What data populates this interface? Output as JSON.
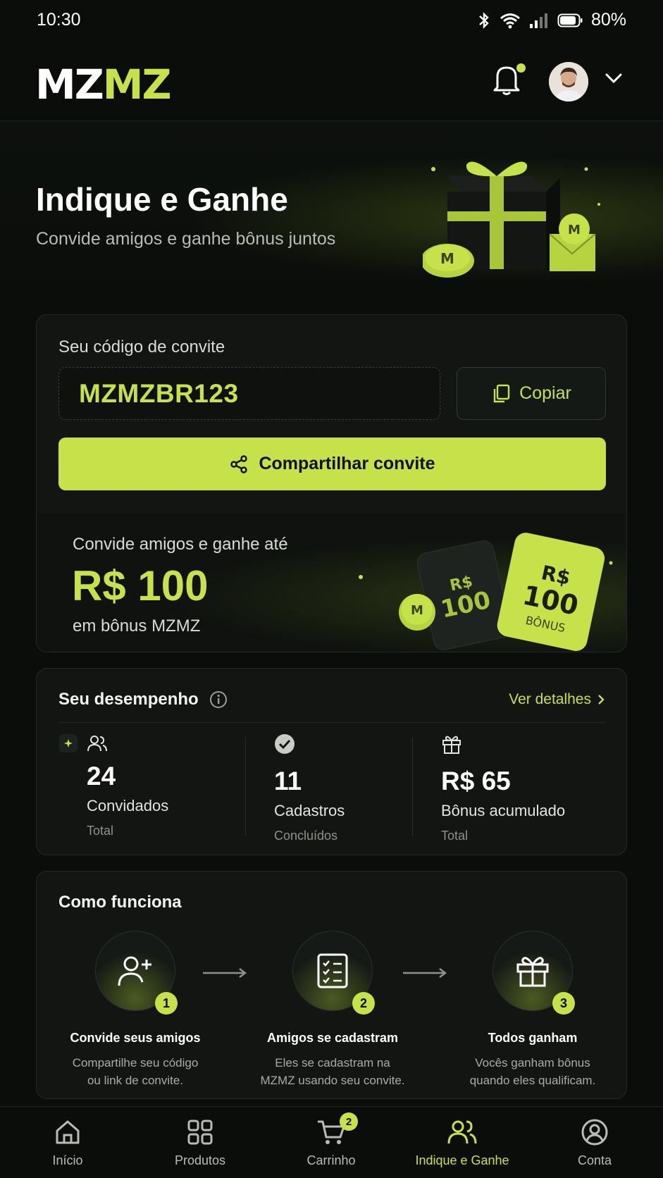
{
  "status_bar": {
    "time": "10:30",
    "battery": "80%"
  },
  "header": {
    "logo_part1": "MZ",
    "logo_part2": "MZ"
  },
  "hero": {
    "title": "Indique e Ganhe",
    "subtitle": "Convide amigos e ganhe bônus juntos"
  },
  "invite": {
    "label": "Seu código de convite",
    "code": "MZMZBR123",
    "copy_label": "Copiar",
    "share_label": "Compartilhar convite",
    "bonus_line1": "Convide amigos e ganhe até",
    "bonus_amount": "R$ 100",
    "bonus_line3": "em bônus MZMZ",
    "voucher_currency": "R$",
    "voucher_value": "100",
    "voucher_word": "BÔNUS"
  },
  "performance": {
    "title": "Seu desempenho",
    "details_link": "Ver detalhes",
    "stats": [
      {
        "icon": "users-icon",
        "value": "24",
        "label": "Convidados",
        "sub": "Total"
      },
      {
        "icon": "check-circle-icon",
        "value": "11",
        "label": "Cadastros",
        "sub": "Concluídos"
      },
      {
        "icon": "gift-icon",
        "value": "R$ 65",
        "label": "Bônus acumulado",
        "sub": "Total"
      }
    ]
  },
  "how": {
    "title": "Como funciona",
    "steps": [
      {
        "number": "1",
        "title": "Convide seus amigos",
        "desc1": "Compartilhe seu código",
        "desc2": "ou link de convite."
      },
      {
        "number": "2",
        "title": "Amigos se cadastram",
        "desc1": "Eles se cadastram na",
        "desc2": "MZMZ usando seu convite."
      },
      {
        "number": "3",
        "title": "Todos ganham",
        "desc1": "Vocês ganham bônus",
        "desc2": "quando eles qualificam."
      }
    ]
  },
  "bottom_nav": {
    "items": [
      {
        "label": "Início",
        "icon": "home-icon"
      },
      {
        "label": "Produtos",
        "icon": "grid-icon"
      },
      {
        "label": "Carrinho",
        "icon": "cart-icon",
        "badge": "2"
      },
      {
        "label": "Indique e Ganhe",
        "icon": "users-icon",
        "active": true
      },
      {
        "label": "Conta",
        "icon": "account-icon"
      }
    ]
  },
  "colors": {
    "accent": "#c6e14a",
    "background": "#0b0d0b",
    "card": "#121512"
  }
}
